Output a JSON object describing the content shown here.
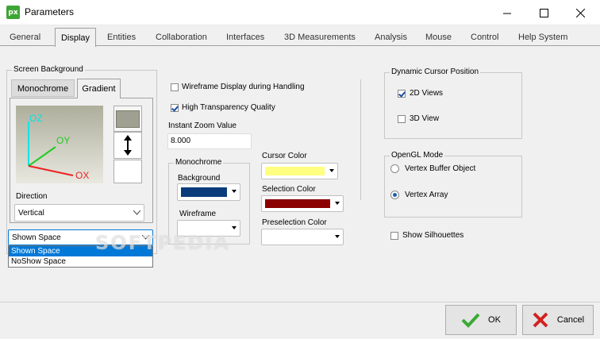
{
  "window": {
    "title": "Parameters",
    "icon_text": "px"
  },
  "tabs": [
    "General",
    "Display",
    "Entities",
    "Collaboration",
    "Interfaces",
    "3D Measurements",
    "Analysis",
    "Mouse",
    "Control",
    "Help System"
  ],
  "active_tab": "Display",
  "screen_background": {
    "title": "Screen Background",
    "subtabs": [
      "Monochrome",
      "Gradient"
    ],
    "active_subtab": "Gradient",
    "axes": {
      "oz": "OZ",
      "oy": "OY",
      "ox": "OX"
    },
    "direction_label": "Direction",
    "direction_value": "Vertical",
    "space_value": "Shown Space",
    "space_options": [
      "Shown Space",
      "NoShow Space"
    ]
  },
  "display_options": {
    "wireframe_label": "Wireframe Display during Handling",
    "wireframe_checked": false,
    "transparency_label": "High Transparency Quality",
    "transparency_checked": true,
    "zoom_label": "Instant Zoom Value",
    "zoom_value": "8.000"
  },
  "monochrome": {
    "title": "Monochrome",
    "background_label": "Background",
    "background_color": "#0a3c7c",
    "wireframe_label": "Wireframe",
    "wireframe_color": "#ffffff"
  },
  "colors": {
    "cursor_label": "Cursor Color",
    "cursor_color": "#ffff80",
    "selection_label": "Selection Color",
    "selection_color": "#8b0000",
    "preselection_label": "Preselection Color",
    "preselection_color": "#ffffff"
  },
  "dynamic_cursor": {
    "title": "Dynamic Cursor Position",
    "views_2d_label": "2D Views",
    "views_2d_checked": true,
    "view_3d_label": "3D View",
    "view_3d_checked": false
  },
  "opengl": {
    "title": "OpenGL Mode",
    "options": [
      "Vertex Buffer Object",
      "Vertex Array"
    ],
    "selected": "Vertex Array"
  },
  "show_silhouettes": {
    "label": "Show Silhouettes",
    "checked": false
  },
  "watermark": "SOFTPEDIA",
  "buttons": {
    "ok": "OK",
    "cancel": "Cancel"
  }
}
